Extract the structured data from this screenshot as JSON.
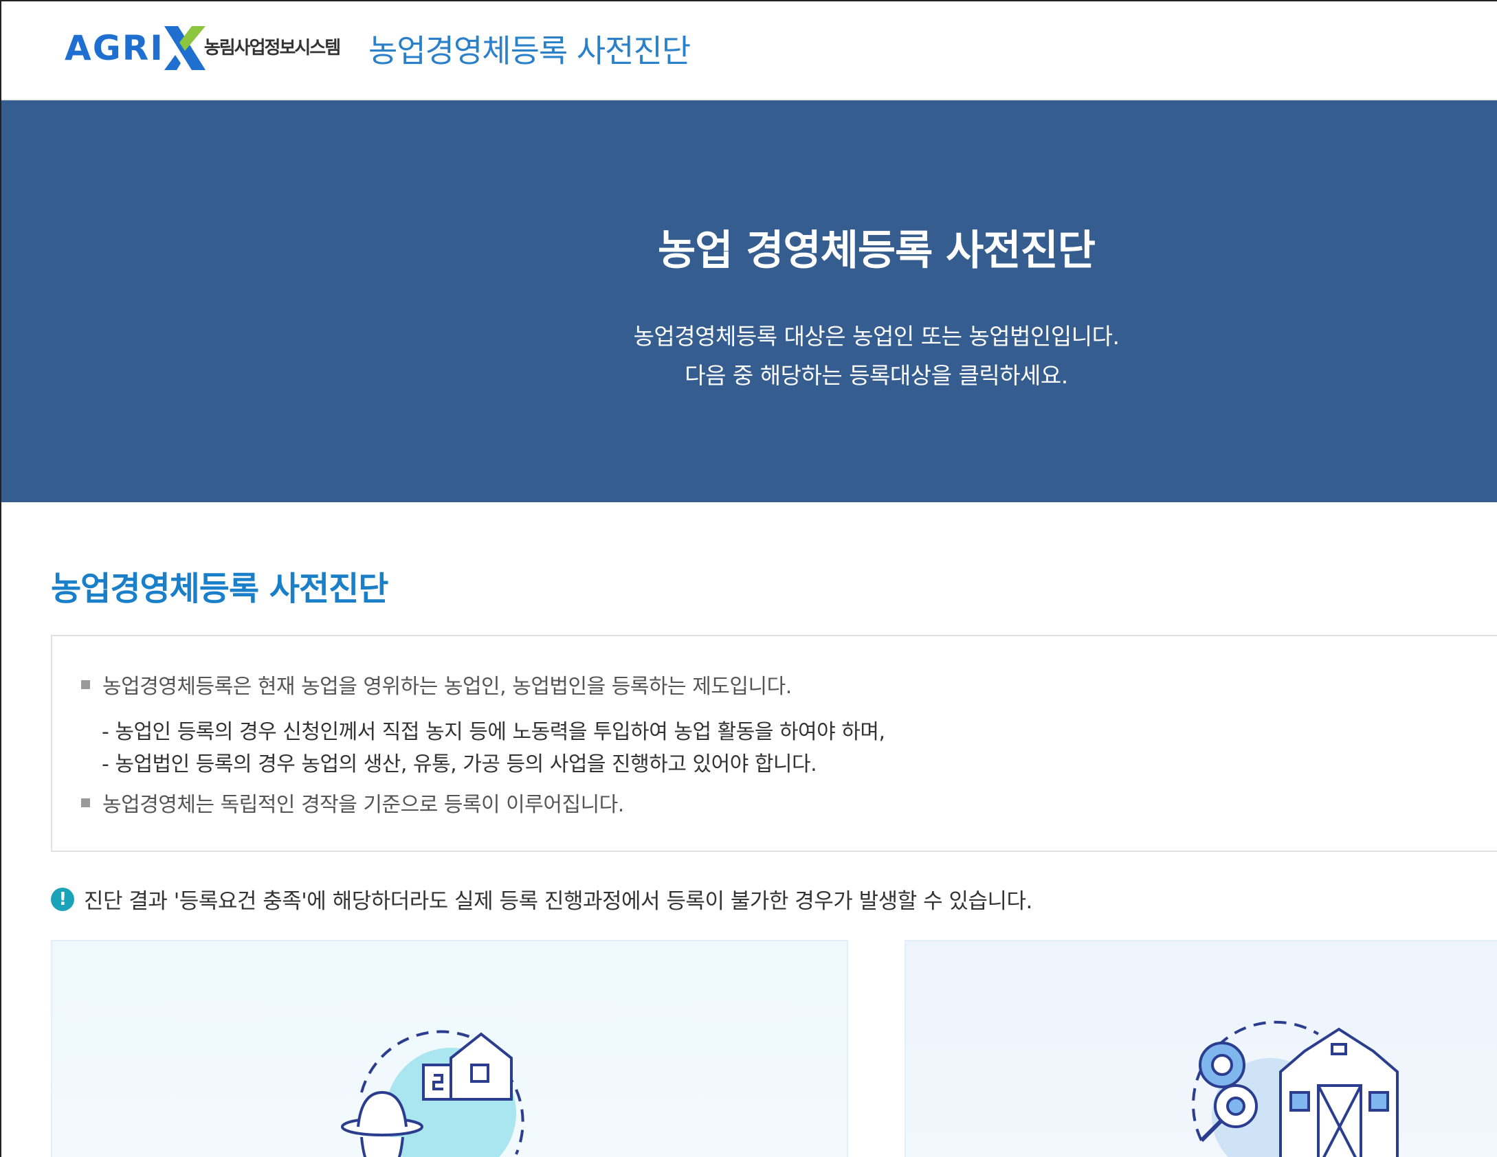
{
  "header": {
    "logo_text": "AGRI",
    "logo_subtext": "농림사업정보시스템",
    "title": "농업경영체등록 사전진단"
  },
  "hero": {
    "title": "농업 경영체등록 사전진단",
    "subtitle_line1": "농업경영체등록 대상은 농업인 또는 농업법인입니다.",
    "subtitle_line2": "다음 중 해당하는 등록대상을 클릭하세요."
  },
  "section": {
    "title": "농업경영체등록 사전진단",
    "info": {
      "bullet1": "농업경영체등록은 현재 농업을 영위하는 농업인, 농업법인을 등록하는 제도입니다.",
      "sub1": "- 농업인 등록의 경우 신청인께서 직접 농지 등에 노동력을 투입하여 농업 활동을 하여야 하며,",
      "sub2": "- 농업법인 등록의 경우 농업의 생산, 유통, 가공 등의 사업을 진행하고 있어야 합니다.",
      "bullet2": "농업경영체는 독립적인 경작을 기준으로 등록이 이루어집니다."
    },
    "notice": "진단 결과 '등록요건 충족'에 해당하더라도 실제 등록 진행과정에서 등록이 불가한 경우가 발생할 수 있습니다."
  },
  "icons": {
    "notice": "exclamation-icon",
    "farmer_card": "farmer-house-icon",
    "corp_card": "barn-gear-icon"
  },
  "colors": {
    "hero_bg": "#355d8f",
    "header_title": "#2a80c9",
    "section_title": "#1a7fc9",
    "notice_icon": "#1aa3b8",
    "logo_blue": "#1e6fd0",
    "logo_green": "#8cc63f"
  }
}
